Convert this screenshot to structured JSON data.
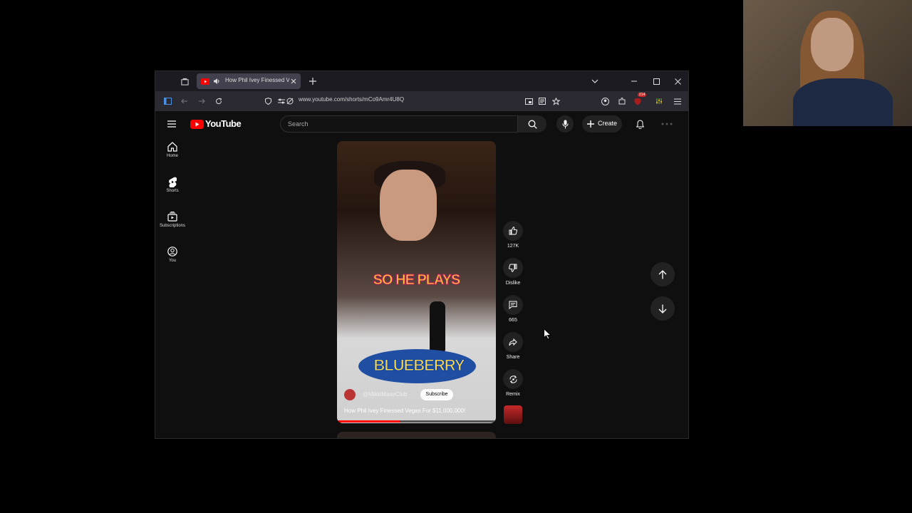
{
  "browser": {
    "tab_title": "How Phil Ivey Finessed Vegas",
    "url": "www.youtube.com/shorts/mCo9Amr4U8Q",
    "extension_badge": "214"
  },
  "youtube": {
    "logo_text": "YouTube",
    "search_placeholder": "Search",
    "create_label": "Create",
    "sidebar": [
      {
        "label": "Home"
      },
      {
        "label": "Shorts"
      },
      {
        "label": "Subscriptions"
      },
      {
        "label": "You"
      }
    ],
    "short": {
      "caption_overlay": "SO HE PLAYS",
      "shirt_text": "BLUEBERRY",
      "channel": "@MikkiMaseClub",
      "subscribe_label": "Subscribe",
      "title": "How Phil Ivey Finessed Vegas For $11,000,000!",
      "progress_fraction": 0.4
    },
    "actions": {
      "like_count": "127K",
      "dislike_label": "Dislike",
      "comment_count": "665",
      "share_label": "Share",
      "remix_label": "Remix"
    }
  },
  "icons": [
    "home-icon",
    "shorts-icon",
    "subscriptions-icon",
    "you-icon",
    "search-icon",
    "mic-icon",
    "plus-icon",
    "bell-icon",
    "like-icon",
    "dislike-icon",
    "comment-icon",
    "share-icon",
    "remix-icon",
    "arrow-up-icon",
    "arrow-down-icon"
  ],
  "colors": {
    "youtube_red": "#ff0000",
    "background": "#0f0f0f"
  }
}
